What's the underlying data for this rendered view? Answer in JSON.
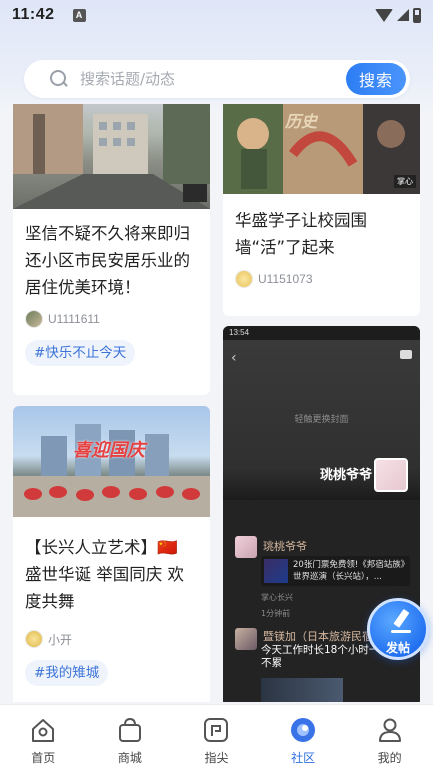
{
  "status_bar": {
    "time": "11:42",
    "indicator": "A"
  },
  "search": {
    "placeholder": "搜索话题/动态",
    "button": "搜索"
  },
  "feed": {
    "left_column": [
      {
        "title": "坚信不疑不久将来即归还小区市民安居乐业的居住优美环境！",
        "author": "U1111611",
        "tag": "#快乐不止今天",
        "image_icon": "street-photo"
      },
      {
        "title": "【长兴人立艺术】🇨🇳 盛世华诞 举国同庆 欢度共舞",
        "author": "小开",
        "tag": "#我的雉城",
        "image_icon": "plaza-dance-photo",
        "image_caption": "喜迎国庆"
      }
    ],
    "right_column": [
      {
        "title": "华盛学子让校园围墙“活”了起来",
        "author": "U1151073",
        "image_icon": "mural-photo",
        "image_badge": "掌心",
        "image_caption": "历史"
      },
      {
        "screenshot": {
          "time": "13:54",
          "cover_label": "轻触更换封面",
          "user_name": "珧桃爷爷",
          "comment_author": "珧桃爷爷",
          "song_text": "20张门票免费领!《邦宿站族》世界巡演（长兴站），...",
          "meta": "掌心长兴",
          "time_ago": "1分钟前",
          "second_author": "暨镁加（日本旅游民宿）",
          "second_comment": "今天工作时长18个小时一点也不累"
        }
      }
    ]
  },
  "fab": {
    "label": "发帖"
  },
  "bottom_nav": [
    {
      "label": "首页",
      "icon": "home-icon",
      "active": false
    },
    {
      "label": "商城",
      "icon": "shopping-bag-icon",
      "active": false
    },
    {
      "label": "指尖",
      "icon": "fingertip-icon",
      "active": false
    },
    {
      "label": "社区",
      "icon": "community-icon",
      "active": true
    },
    {
      "label": "我的",
      "icon": "profile-icon",
      "active": false
    }
  ],
  "colors": {
    "accent": "#2f6fe0",
    "tag_bg": "#eef3fc",
    "tag_text": "#3c74d8"
  }
}
